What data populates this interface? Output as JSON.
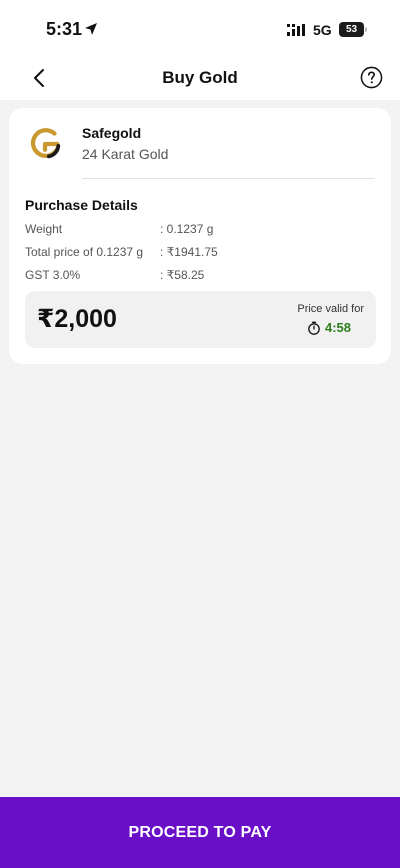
{
  "status_bar": {
    "time": "5:31",
    "network": "5G",
    "battery": "53"
  },
  "header": {
    "title": "Buy Gold"
  },
  "product": {
    "vendor": "Safegold",
    "subtitle": "24 Karat Gold"
  },
  "purchase_details": {
    "title": "Purchase Details",
    "rows": [
      {
        "label": "Weight",
        "value": ": 0.1237 g"
      },
      {
        "label": "Total price of 0.1237 g",
        "value": ": ₹1941.75"
      },
      {
        "label": "GST 3.0%",
        "value": ": ₹58.25"
      }
    ]
  },
  "price": {
    "amount": "₹2,000",
    "valid_label": "Price valid for",
    "timer": "4:58"
  },
  "footer": {
    "proceed_label": "PROCEED TO PAY"
  },
  "colors": {
    "primary": "#6a0fc8",
    "timer_green": "#2f7d1d",
    "logo_gold": "#c9982f"
  },
  "icons": [
    "location-arrow-icon",
    "signal-icon",
    "back-chevron-icon",
    "help-icon",
    "safegold-logo",
    "timer-icon"
  ]
}
